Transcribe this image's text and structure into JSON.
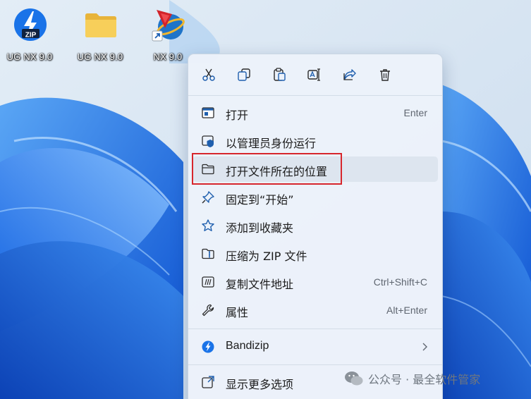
{
  "desktop": {
    "icons": [
      {
        "label": "UG NX 9.0",
        "icon": "zip-archive-icon"
      },
      {
        "label": "UG NX 9.0",
        "icon": "folder-icon"
      },
      {
        "label": "NX 9.0",
        "icon": "nx-app-shortcut-icon"
      }
    ]
  },
  "context_menu": {
    "toolbar": [
      {
        "name": "cut",
        "icon": "scissors-icon"
      },
      {
        "name": "copy",
        "icon": "copy-icon"
      },
      {
        "name": "paste",
        "icon": "paste-icon"
      },
      {
        "name": "rename",
        "icon": "rename-icon"
      },
      {
        "name": "share",
        "icon": "share-icon"
      },
      {
        "name": "delete",
        "icon": "trash-icon"
      }
    ],
    "items": [
      {
        "label": "打开",
        "shortcut": "Enter",
        "icon": "window-icon"
      },
      {
        "label": "以管理员身份运行",
        "shortcut": "",
        "icon": "shield-icon"
      },
      {
        "label": "打开文件所在的位置",
        "shortcut": "",
        "icon": "folder-outline-icon"
      },
      {
        "label": "固定到“开始”",
        "shortcut": "",
        "icon": "pin-icon"
      },
      {
        "label": "添加到收藏夹",
        "shortcut": "",
        "icon": "star-icon"
      },
      {
        "label": "压缩为 ZIP 文件",
        "shortcut": "",
        "icon": "zip-folder-icon"
      },
      {
        "label": "复制文件地址",
        "shortcut": "Ctrl+Shift+C",
        "icon": "path-icon"
      },
      {
        "label": "属性",
        "shortcut": "Alt+Enter",
        "icon": "wrench-icon"
      },
      {
        "label": "Bandizip",
        "shortcut": "",
        "icon": "bandizip-icon"
      },
      {
        "label": "显示更多选项",
        "shortcut": "",
        "icon": "expand-icon"
      }
    ]
  },
  "watermark": {
    "text": "公众号 · 最全软件管家"
  },
  "colors": {
    "accent": "#0067c0",
    "highlight_box": "#d7262c",
    "menu_bg": "#ecf2fa"
  }
}
